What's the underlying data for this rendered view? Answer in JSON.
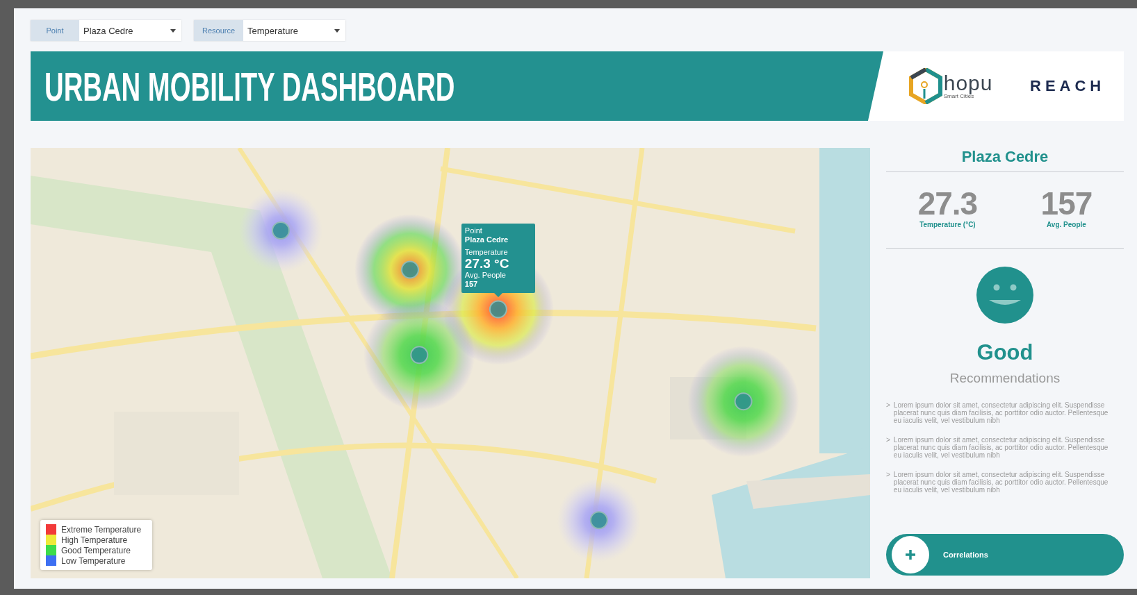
{
  "filters": [
    {
      "label": "Point",
      "value": "Plaza Cedre"
    },
    {
      "label": "Resource",
      "value": "Temperature"
    }
  ],
  "banner": {
    "title": "URBAN MOBILITY DASHBOARD",
    "logos": [
      {
        "kind": "hopu",
        "name": "hopu",
        "tagline": "Smart Cities"
      },
      {
        "kind": "reach",
        "name": "REACH"
      }
    ]
  },
  "map": {
    "kind": "picture",
    "heat_spots": [
      {
        "kind": "low"
      },
      {
        "kind": "high"
      },
      {
        "kind": "extreme"
      },
      {
        "kind": "good"
      },
      {
        "kind": "good"
      },
      {
        "kind": "low"
      }
    ],
    "tooltip": {
      "point_label": "Point",
      "point": "Plaza Cedre",
      "resource_label": "Temperature",
      "value": "27.3 °C",
      "people_label": "Avg. People",
      "people": "157"
    },
    "legend": [
      {
        "label": "Extreme Temperature",
        "color": "#f23a3a"
      },
      {
        "label": "High Temperature",
        "color": "#eeea3a"
      },
      {
        "label": "Good Temperature",
        "color": "#3ddc4a"
      },
      {
        "label": "Low Temperature",
        "color": "#3d6ff2"
      }
    ]
  },
  "panel": {
    "title": "Plaza Cedre",
    "stats": [
      {
        "value": "27.3",
        "label": "Temperature (°C)"
      },
      {
        "value": "157",
        "label": "Avg. People"
      }
    ],
    "status": {
      "kind": "smile",
      "label": "Good"
    },
    "recommendations_title": "Recommendations",
    "recommendations": [
      {
        "marker": ">",
        "text": "Lorem ipsum dolor sit amet, consectetur adipiscing elit. Suspendisse placerat nunc quis diam facilisis, ac porttitor odio auctor. Pellentesque eu iaculis velit, vel vestibulum nibh"
      },
      {
        "marker": ">",
        "text": "Lorem ipsum dolor sit amet, consectetur adipiscing elit. Suspendisse placerat nunc quis diam facilisis, ac porttitor odio auctor. Pellentesque eu iaculis velit, vel vestibulum nibh"
      },
      {
        "marker": ">",
        "text": "Lorem ipsum dolor sit amet, consectetur adipiscing elit. Suspendisse placerat nunc quis diam facilisis, ac porttitor odio auctor. Pellentesque eu iaculis velit, vel vestibulum nibh"
      }
    ],
    "button": {
      "label": "Correlations"
    }
  }
}
